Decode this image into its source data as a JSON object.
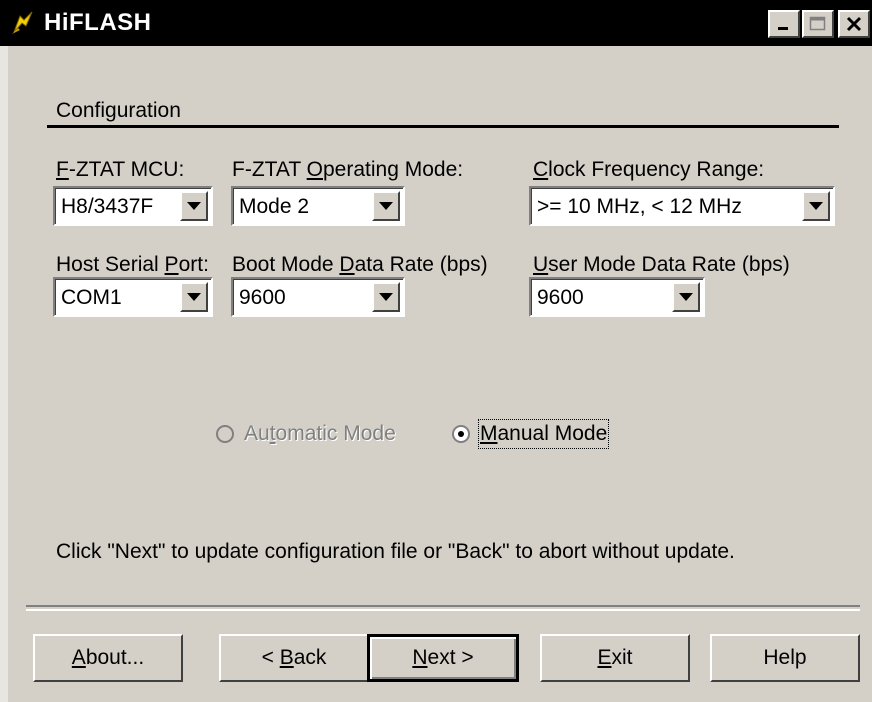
{
  "window": {
    "title": "HiFLASH",
    "controls": [
      "minimize",
      "maximize",
      "close"
    ]
  },
  "section": {
    "title": "Configuration"
  },
  "fields": {
    "mcu": {
      "label_pre": "",
      "label_key": "F",
      "label_post": "-ZTAT MCU:",
      "value": "H8/3437F"
    },
    "operating_mode": {
      "label_pre": "F-ZTAT ",
      "label_key": "O",
      "label_post": "perating Mode:",
      "value": "Mode 2"
    },
    "clock": {
      "label_pre": "",
      "label_key": "C",
      "label_post": "lock Frequency Range:",
      "value": ">= 10 MHz, < 12 MHz"
    },
    "serial_port": {
      "label_pre": "Host Serial ",
      "label_key": "P",
      "label_post": "ort:",
      "value": "COM1"
    },
    "boot_rate": {
      "label_pre": "Boot Mode ",
      "label_key": "D",
      "label_post": "ata Rate (bps)",
      "value": "9600"
    },
    "user_rate": {
      "label_pre": "",
      "label_key": "U",
      "label_post": "ser Mode Data Rate (bps)",
      "value": "9600"
    }
  },
  "modes": {
    "automatic": {
      "pre": "Au",
      "key": "t",
      "post": "omatic Mode",
      "enabled": false,
      "selected": false
    },
    "manual": {
      "pre": "",
      "key": "M",
      "post": "anual Mode",
      "enabled": true,
      "selected": true
    }
  },
  "instruction": "Click \"Next\" to update configuration file or \"Back\" to abort without update.",
  "buttons": {
    "about": {
      "pre": "",
      "key": "A",
      "post": "bout..."
    },
    "back": {
      "pre": "< ",
      "key": "B",
      "post": "ack"
    },
    "next": {
      "pre": "",
      "key": "N",
      "post": "ext >"
    },
    "exit": {
      "pre": "",
      "key": "E",
      "post": "xit"
    },
    "help": {
      "label": "Help"
    }
  },
  "colors": {
    "face": "#d4d0c8",
    "titlebar": "#000000",
    "disabled_text": "#808080"
  }
}
